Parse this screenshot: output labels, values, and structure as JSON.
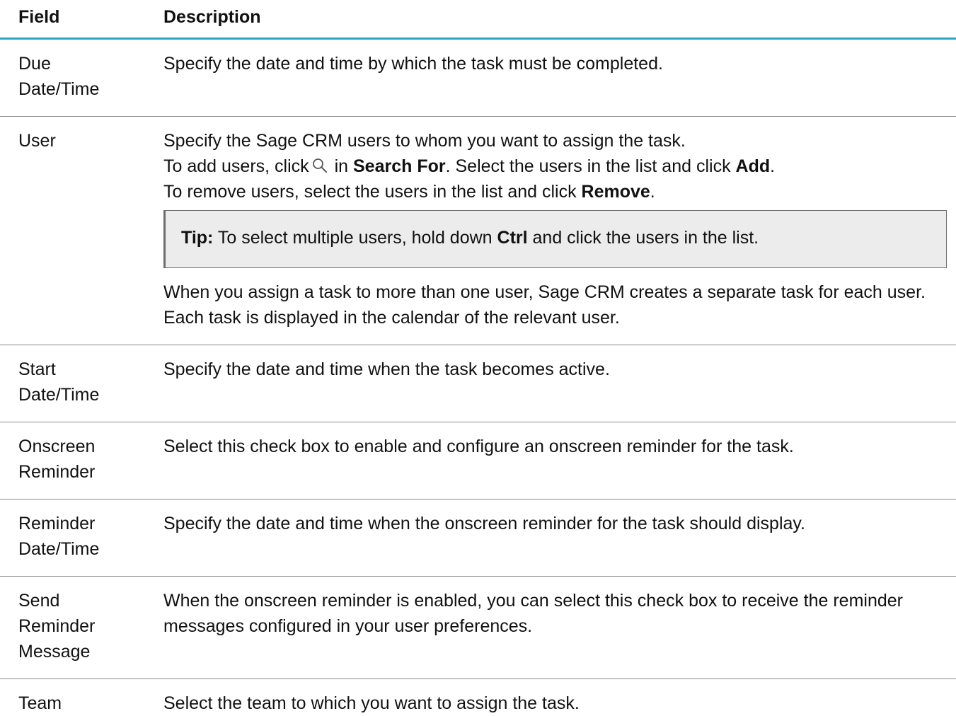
{
  "header": {
    "field_label": "Field",
    "description_label": "Description"
  },
  "rows": [
    {
      "field": [
        "Due",
        "Date/Time"
      ],
      "description": "Specify the date and time by which the task must be completed."
    },
    {
      "field": [
        "User"
      ],
      "line1": "Specify the Sage CRM users to whom you want to assign the task.",
      "line2": {
        "pre": "To add users, click",
        "icon": "search-icon",
        "mid1": " in ",
        "bold1": "Search For",
        "mid2": ". Select the users in the list and click ",
        "bold2": "Add",
        "post": "."
      },
      "line3": {
        "pre": "To remove users, select the users in the list and click ",
        "bold": "Remove",
        "post": "."
      },
      "tip": {
        "label": "Tip:",
        "pre": " To select multiple users, hold down ",
        "bold": "Ctrl",
        "post": " and click the users in the list."
      },
      "line4": "When you assign a task to more than one user, Sage CRM creates a separate task for each user. Each task is displayed in the calendar of the relevant user."
    },
    {
      "field": [
        "Start",
        "Date/Time"
      ],
      "description": "Specify the date and time when the task becomes active."
    },
    {
      "field": [
        "Onscreen",
        "Reminder"
      ],
      "description": "Select this check box to enable and configure an onscreen reminder for the task."
    },
    {
      "field": [
        "Reminder",
        "Date/Time"
      ],
      "description": "Specify the date and time when the onscreen reminder for the task should display."
    },
    {
      "field": [
        "Send",
        "Reminder",
        "Message"
      ],
      "description": "When the onscreen reminder is enabled, you can select this check box to receive the reminder messages configured in your user preferences."
    },
    {
      "field": [
        "Team"
      ],
      "description": "Select the team to which you want to assign the task."
    }
  ],
  "colors": {
    "header_rule": "#2aa7c0",
    "row_rule": "#8a8a8a",
    "tip_background": "#ececec",
    "tip_border": "#6e6e6e"
  }
}
